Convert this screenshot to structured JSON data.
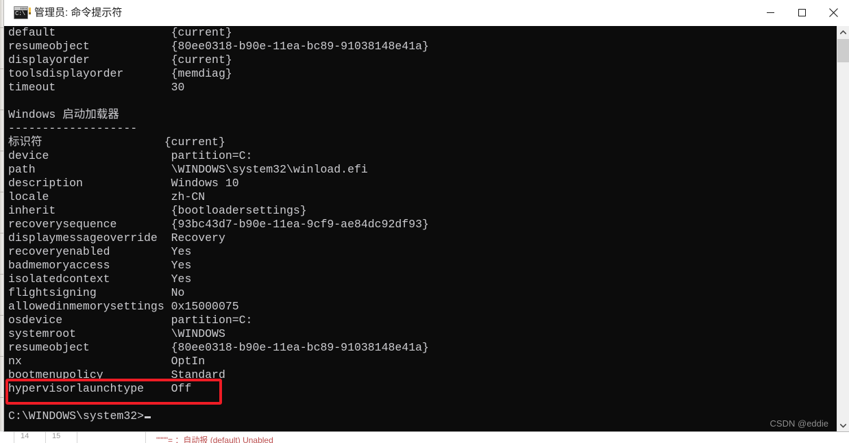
{
  "window": {
    "title": "管理员: 命令提示符",
    "icon": "cmd-icon",
    "icon_text": "C:\\",
    "controls": [
      {
        "name": "minimize-button",
        "label": "最小化",
        "glyph": "minimize"
      },
      {
        "name": "maximize-button",
        "label": "最大化",
        "glyph": "maximize"
      },
      {
        "name": "close-button",
        "label": "关闭",
        "glyph": "close"
      }
    ]
  },
  "console": {
    "foreground_color": "#ccccd0",
    "background_color": "#0c0c0c",
    "lines": [
      "default                 {current}",
      "resumeobject            {80ee0318-b90e-11ea-bc89-91038148e41a}",
      "displayorder            {current}",
      "toolsdisplayorder       {memdiag}",
      "timeout                 30",
      "",
      "Windows 启动加载器",
      "-------------------",
      "标识符                  {current}",
      "device                  partition=C:",
      "path                    \\WINDOWS\\system32\\winload.efi",
      "description             Windows 10",
      "locale                  zh-CN",
      "inherit                 {bootloadersettings}",
      "recoverysequence        {93bc43d7-b90e-11ea-9cf9-ae84dc92df93}",
      "displaymessageoverride  Recovery",
      "recoveryenabled         Yes",
      "badmemoryaccess         Yes",
      "isolatedcontext         Yes",
      "flightsigning           No",
      "allowedinmemorysettings 0x15000075",
      "osdevice                partition=C:",
      "systemroot              \\WINDOWS",
      "resumeobject            {80ee0318-b90e-11ea-bc89-91038148e41a}",
      "nx                      OptIn",
      "bootmenupolicy          Standard",
      "hypervisorlaunchtype    Off"
    ],
    "prompt": "C:\\WINDOWS\\system32>",
    "cursor": "block-cursor"
  },
  "annotation": {
    "name": "red-highlight-box",
    "color": "#ee1c25",
    "targets": "hypervisorlaunchtype    Off"
  },
  "watermark": {
    "text": "CSDN @eddie"
  },
  "scrollbar": {
    "up_arrow": "chevron-up-icon",
    "down_arrow": "chevron-down-icon",
    "thumb": "scrollbar-thumb"
  },
  "background": {
    "row_numbers": [
      "14",
      "15"
    ],
    "red_fragment": "\"\"\"\"=  ：自动报 (default) Unabled"
  }
}
